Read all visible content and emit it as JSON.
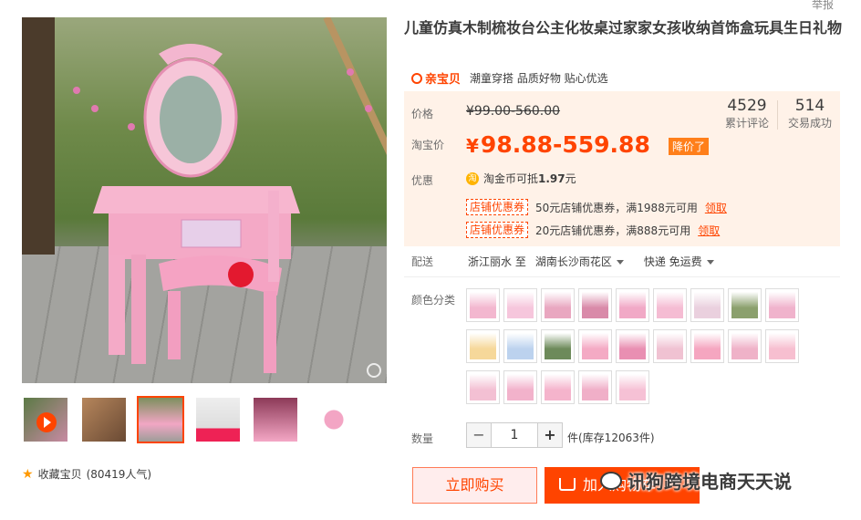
{
  "title": "儿童仿真木制梳妆台公主化妆桌过家家女孩收纳首饰盒玩具生日礼物",
  "report_label": "举报",
  "brand": {
    "logo_text": "亲宝贝",
    "slogan": "潮童穿搭 品质好物 贴心优选"
  },
  "price": {
    "price_label": "价格",
    "original": "¥99.00-560.00",
    "taobao_label": "淘宝价",
    "yen": "¥",
    "current": "98.88-559.88",
    "drop_tag": "降价了"
  },
  "stats": [
    {
      "num": "4529",
      "label": "累计评论"
    },
    {
      "num": "514",
      "label": "交易成功"
    }
  ],
  "promo": {
    "label": "优惠",
    "coin_icon": "淘",
    "coin_text_prefix": "淘金币可抵",
    "coin_amount": "1.97",
    "coin_suffix": "元",
    "coupons": [
      {
        "tag": "店铺优惠券",
        "text": "50元店铺优惠券，满1988元可用",
        "link": "领取"
      },
      {
        "tag": "店铺优惠券",
        "text": "20元店铺优惠券，满888元可用",
        "link": "领取"
      }
    ]
  },
  "shipping": {
    "label": "配送",
    "from": "浙江丽水 至",
    "to": "湖南长沙雨花区",
    "method": "快递 免运费"
  },
  "colors": {
    "label": "颜色分类",
    "swatch_count": 23
  },
  "quantity": {
    "label": "数量",
    "value": "1",
    "minus": "−",
    "plus": "+",
    "stock": "件(库存12063件)"
  },
  "actions": {
    "buy_now": "立即购买",
    "add_cart": "加入购物车"
  },
  "favorite": {
    "label": "收藏宝贝",
    "count": "(80419人气)"
  },
  "watermark": "讯狗跨境电商天天说",
  "accent_color": "#ff4400"
}
